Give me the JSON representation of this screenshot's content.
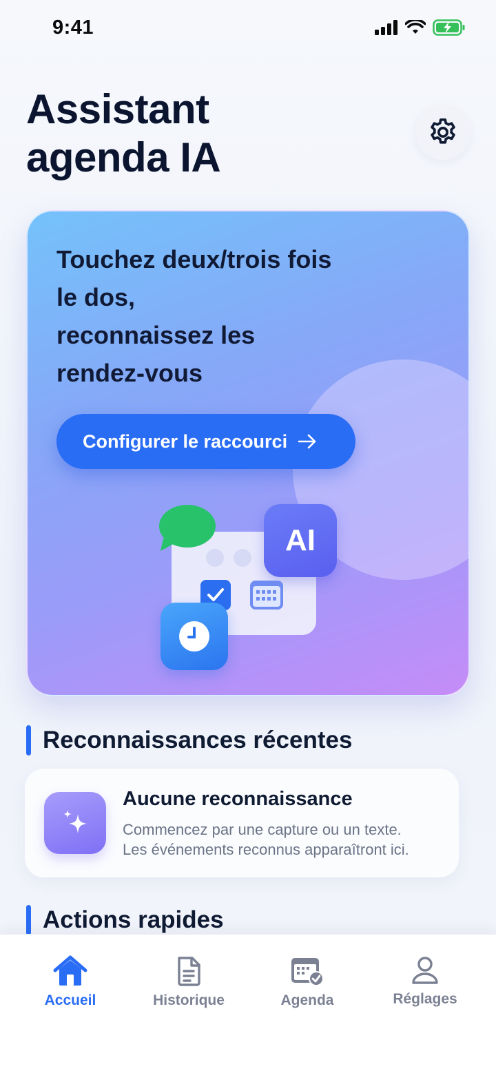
{
  "status_bar": {
    "time": "9:41"
  },
  "header": {
    "title_line1": "Assistant",
    "title_line2": "agenda IA"
  },
  "hero": {
    "title_lines": [
      "Touchez deux/trois fois",
      "le dos,",
      "reconnaissez les",
      "rendez-vous"
    ],
    "cta_label": "Configurer le raccourci",
    "ai_badge": "AI"
  },
  "recent": {
    "section_title": "Reconnaissances récentes",
    "empty_title": "Aucune reconnaissance",
    "empty_desc_line1": "Commencez par une capture ou un texte.",
    "empty_desc_line2": "Les événements reconnus apparaîtront ici."
  },
  "quick_actions": {
    "section_title": "Actions rapides"
  },
  "tab_bar": {
    "items": [
      {
        "label": "Accueil",
        "icon": "home-icon",
        "active": true
      },
      {
        "label": "Historique",
        "icon": "document-icon",
        "active": false
      },
      {
        "label": "Agenda",
        "icon": "calendar-check-icon",
        "active": false
      },
      {
        "label": "Réglages",
        "icon": "person-icon",
        "active": false
      }
    ]
  },
  "colors": {
    "accent": "#2a6df5",
    "text": "#0f1a33",
    "muted": "#7b8193"
  }
}
